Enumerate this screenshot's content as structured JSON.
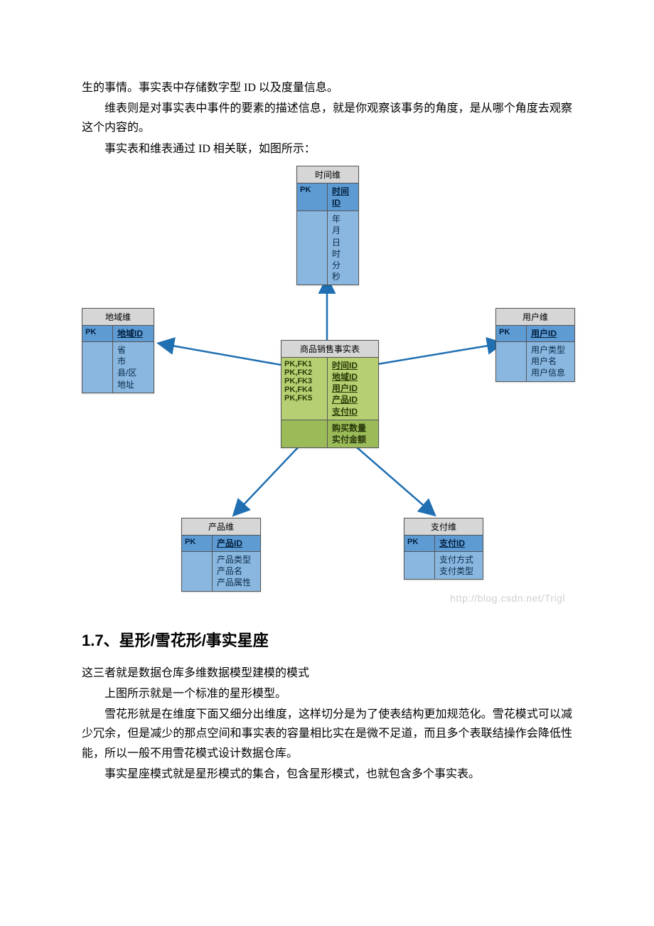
{
  "intro": {
    "p1": "生的事情。事实表中存储数字型 ID 以及度量信息。",
    "p2": "维表则是对事实表中事件的要素的描述信息，就是你观察该事务的角度，是从哪个角度去观察这个内容的。",
    "p3": "事实表和维表通过 ID 相关联，如图所示："
  },
  "diagram": {
    "watermark": "http://blog.csdn.net/Trigl",
    "time": {
      "title": "时间维",
      "pk_label": "PK",
      "pk_value": "时间ID",
      "attrs": "年\n月\n日\n时\n分\n秒"
    },
    "region": {
      "title": "地域维",
      "pk_label": "PK",
      "pk_value": "地域ID",
      "attrs": "省\n市\n县/区\n地址"
    },
    "user": {
      "title": "用户维",
      "pk_label": "PK",
      "pk_value": "用户ID",
      "attrs": "用户类型\n用户名\n用户信息"
    },
    "product": {
      "title": "产品维",
      "pk_label": "PK",
      "pk_value": "产品ID",
      "attrs": "产品类型\n产品名\n产品属性"
    },
    "payment": {
      "title": "支付维",
      "pk_label": "PK",
      "pk_value": "支付ID",
      "attrs": "支付方式\n支付类型"
    },
    "fact": {
      "title": "商品销售事实表",
      "keys": [
        {
          "k": "PK,FK1",
          "v": "时间ID"
        },
        {
          "k": "PK,FK2",
          "v": "地域ID"
        },
        {
          "k": "PK,FK3",
          "v": "用户ID"
        },
        {
          "k": "PK,FK4",
          "v": "产品ID"
        },
        {
          "k": "PK,FK5",
          "v": "支付ID"
        }
      ],
      "measures": "购买数量\n实付金额"
    }
  },
  "section": {
    "heading": "1.7、星形/雪花形/事实星座",
    "p1": "这三者就是数据仓库多维数据模型建模的模式",
    "p2": "上图所示就是一个标准的星形模型。",
    "p3": "雪花形就是在维度下面又细分出维度，这样切分是为了使表结构更加规范化。雪花模式可以减少冗余，但是减少的那点空间和事实表的容量相比实在是微不足道，而且多个表联结操作会降低性能，所以一般不用雪花模式设计数据仓库。",
    "p4": "事实星座模式就是星形模式的集合，包含星形模式，也就包含多个事实表。"
  }
}
